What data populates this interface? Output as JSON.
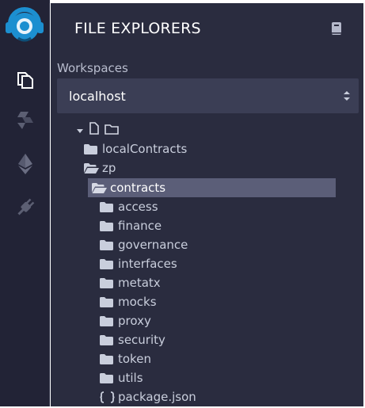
{
  "panel": {
    "title": "FILE EXPLORERS"
  },
  "workspaces": {
    "label": "Workspaces",
    "selected": "localhost"
  },
  "tree": {
    "top": [
      {
        "label": "localContracts",
        "icon": "folder-icon"
      },
      {
        "label": "zp",
        "icon": "folder-open-icon"
      }
    ],
    "contracts": {
      "label": "contracts",
      "icon": "folder-open-icon"
    },
    "children": [
      {
        "label": "access",
        "icon": "folder-icon"
      },
      {
        "label": "finance",
        "icon": "folder-icon"
      },
      {
        "label": "governance",
        "icon": "folder-icon"
      },
      {
        "label": "interfaces",
        "icon": "folder-icon"
      },
      {
        "label": "metatx",
        "icon": "folder-icon"
      },
      {
        "label": "mocks",
        "icon": "folder-icon"
      },
      {
        "label": "proxy",
        "icon": "folder-icon"
      },
      {
        "label": "security",
        "icon": "folder-icon"
      },
      {
        "label": "token",
        "icon": "folder-icon"
      },
      {
        "label": "utils",
        "icon": "folder-icon"
      },
      {
        "label": "package.json",
        "icon": "json-file-icon"
      }
    ]
  },
  "colors": {
    "rail": "#222336",
    "panel": "#2a2c3f",
    "select": "#3b3e55",
    "selected_row": "#5b5e78",
    "logo": "#1c8fd0"
  }
}
